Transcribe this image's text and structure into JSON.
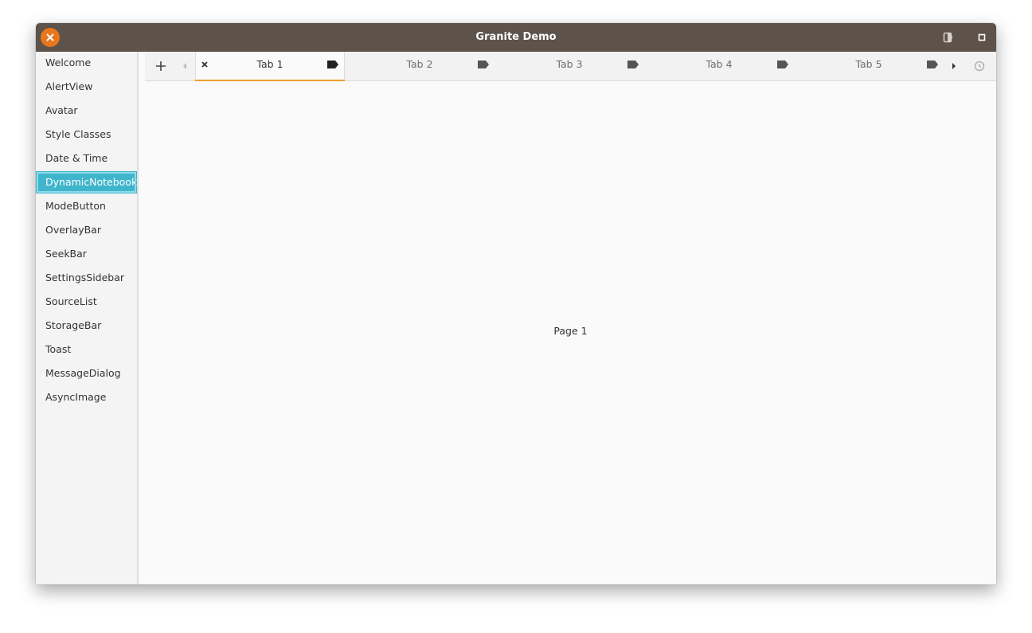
{
  "window": {
    "title": "Granite Demo"
  },
  "sidebar": {
    "items": [
      {
        "label": "Welcome"
      },
      {
        "label": "AlertView"
      },
      {
        "label": "Avatar"
      },
      {
        "label": "Style Classes"
      },
      {
        "label": "Date & Time"
      },
      {
        "label": "DynamicNotebook",
        "selected": true
      },
      {
        "label": "ModeButton"
      },
      {
        "label": "OverlayBar"
      },
      {
        "label": "SeekBar"
      },
      {
        "label": "SettingsSidebar"
      },
      {
        "label": "SourceList"
      },
      {
        "label": "StorageBar"
      },
      {
        "label": "Toast"
      },
      {
        "label": "MessageDialog"
      },
      {
        "label": "AsyncImage"
      }
    ]
  },
  "notebook": {
    "tabs": [
      {
        "label": "Tab 1",
        "active": true
      },
      {
        "label": "Tab 2"
      },
      {
        "label": "Tab 3"
      },
      {
        "label": "Tab 4"
      },
      {
        "label": "Tab 5"
      }
    ],
    "page_label": "Page 1"
  },
  "colors": {
    "titlebar": "#5d534b",
    "close_button": "#e8761c",
    "selection": "#3fb5cc",
    "active_tab_indicator": "#f0a030"
  },
  "icons": {
    "close": "close-icon",
    "mode_toggle": "mode-toggle-icon",
    "maximize": "maximize-icon",
    "new_tab": "plus-icon",
    "scroll_left": "chevron-left-icon",
    "scroll_right": "chevron-right-icon",
    "restore_tab": "history-icon",
    "tab_close": "close-icon",
    "tab_tag": "tag-icon"
  }
}
